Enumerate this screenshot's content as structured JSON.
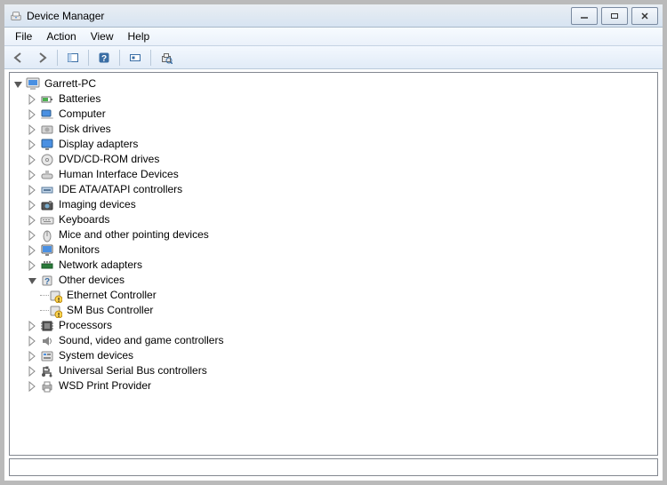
{
  "window": {
    "title": "Device Manager"
  },
  "menu": {
    "file": "File",
    "action": "Action",
    "view": "View",
    "help": "Help"
  },
  "tree": {
    "root": {
      "label": "Garrett-PC",
      "expanded": true
    },
    "categories": [
      {
        "label": "Batteries",
        "icon": "battery"
      },
      {
        "label": "Computer",
        "icon": "computer"
      },
      {
        "label": "Disk drives",
        "icon": "disk"
      },
      {
        "label": "Display adapters",
        "icon": "display"
      },
      {
        "label": "DVD/CD-ROM drives",
        "icon": "cdrom"
      },
      {
        "label": "Human Interface Devices",
        "icon": "hid"
      },
      {
        "label": "IDE ATA/ATAPI controllers",
        "icon": "ide"
      },
      {
        "label": "Imaging devices",
        "icon": "imaging"
      },
      {
        "label": "Keyboards",
        "icon": "keyboard"
      },
      {
        "label": "Mice and other pointing devices",
        "icon": "mouse"
      },
      {
        "label": "Monitors",
        "icon": "monitor"
      },
      {
        "label": "Network adapters",
        "icon": "network"
      },
      {
        "label": "Other devices",
        "icon": "other",
        "expanded": true,
        "children": [
          {
            "label": "Ethernet Controller",
            "icon": "unknown"
          },
          {
            "label": "SM Bus Controller",
            "icon": "unknown"
          }
        ]
      },
      {
        "label": "Processors",
        "icon": "processor"
      },
      {
        "label": "Sound, video and game controllers",
        "icon": "sound"
      },
      {
        "label": "System devices",
        "icon": "system"
      },
      {
        "label": "Universal Serial Bus controllers",
        "icon": "usb"
      },
      {
        "label": "WSD Print Provider",
        "icon": "printer"
      }
    ]
  }
}
